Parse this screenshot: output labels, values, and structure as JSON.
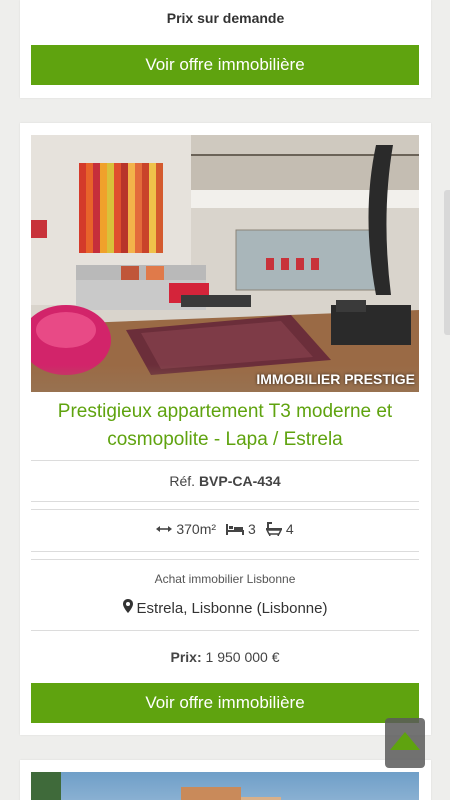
{
  "top_card": {
    "price_text": "Prix sur demande",
    "cta_label": "Voir offre immobilière"
  },
  "listing": {
    "badge": "IMMOBILIER PRESTIGE",
    "title": "Prestigieux appartement T3 moderne et cosmopolite - Lapa / Estrela",
    "ref_label": "Réf.",
    "ref_value": "BVP-CA-434",
    "area": "370m²",
    "bedrooms": "3",
    "bathrooms": "4",
    "category": "Achat immobilier Lisbonne",
    "location": "Estrela, Lisbonne (Lisbonne)",
    "price_label": "Prix:",
    "price_value": "1 950 000 €",
    "cta_label": "Voir offre immobilière",
    "icons": [
      "arrows-h-icon",
      "bed-icon",
      "bath-icon",
      "map-marker-icon"
    ]
  },
  "colors": {
    "accent": "#5fa30f",
    "background": "#eeeeec"
  }
}
